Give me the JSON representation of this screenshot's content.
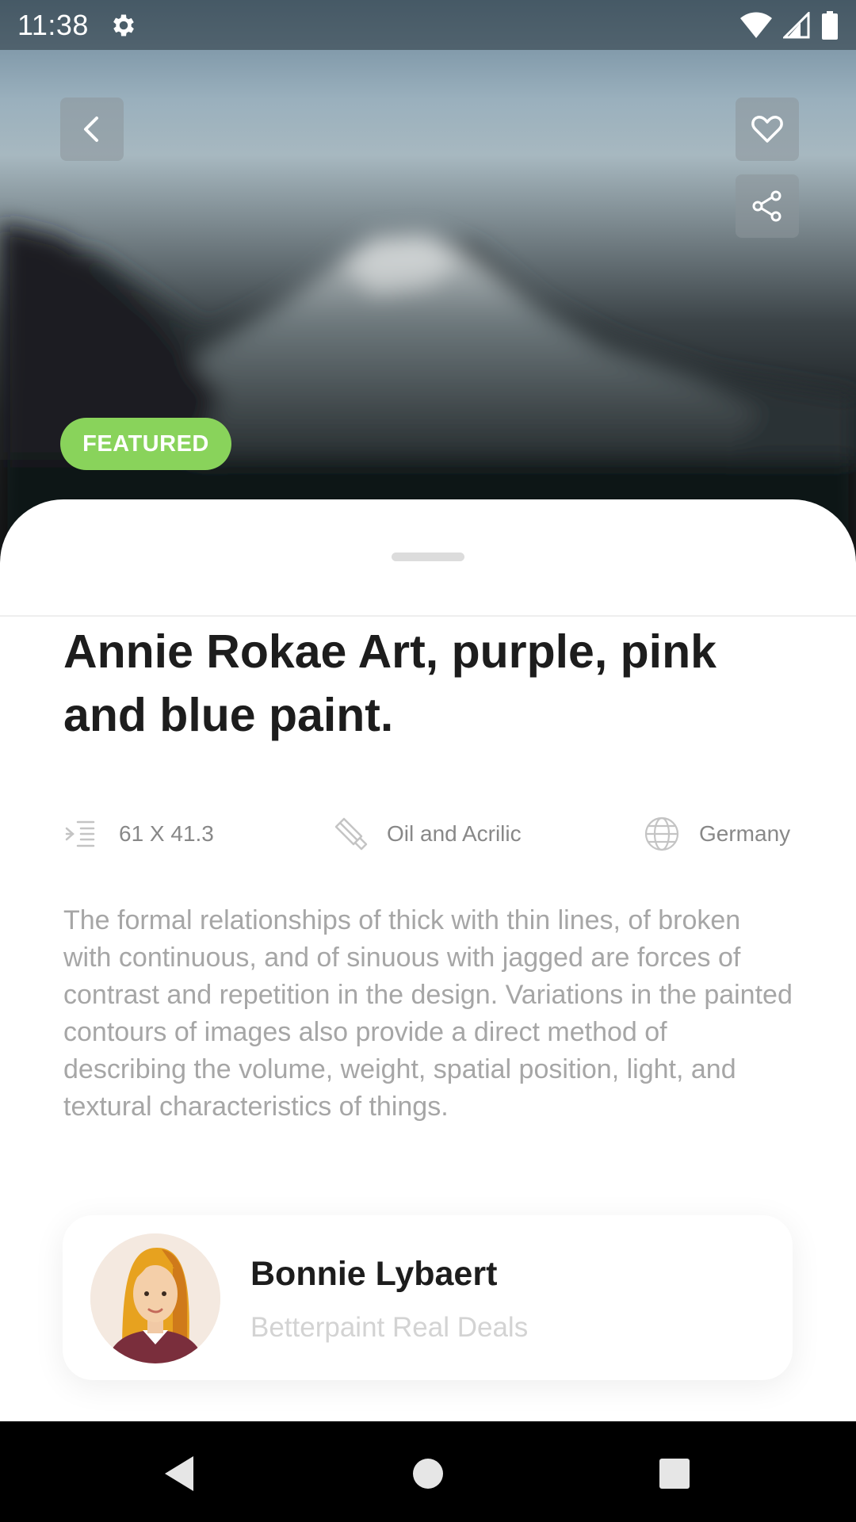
{
  "status_bar": {
    "time": "11:38",
    "icons": [
      "gear-icon",
      "wifi-icon",
      "signal-icon",
      "battery-icon"
    ]
  },
  "hero": {
    "badge": "FEATURED",
    "buttons": [
      "back-icon",
      "heart-icon",
      "share-icon"
    ]
  },
  "artwork": {
    "title": "Annie Rokae Art, purple, pink and blue paint.",
    "specs": [
      {
        "icon": "dimensions-icon",
        "label": "61 X 41.3"
      },
      {
        "icon": "paintbrush-icon",
        "label": "Oil and Acrilic"
      },
      {
        "icon": "globe-icon",
        "label": "Germany"
      }
    ],
    "description": "The formal relationships of thick with thin lines, of broken with continuous, and of sinuous with jagged are forces of contrast and repetition in the design. Variations in the painted contours of images also provide a direct method of describing the volume, weight, spatial position, light, and textural characteristics of things."
  },
  "seller": {
    "name": "Bonnie Lybaert",
    "company": "Betterpaint Real Deals"
  },
  "nav_bar": {
    "buttons": [
      "nav-back-icon",
      "nav-home-icon",
      "nav-recents-icon"
    ]
  },
  "colors": {
    "badge": "#89d35b",
    "title": "#1d1d1d",
    "body_text": "#a6a6a6",
    "company_text": "#d3d3d3"
  }
}
